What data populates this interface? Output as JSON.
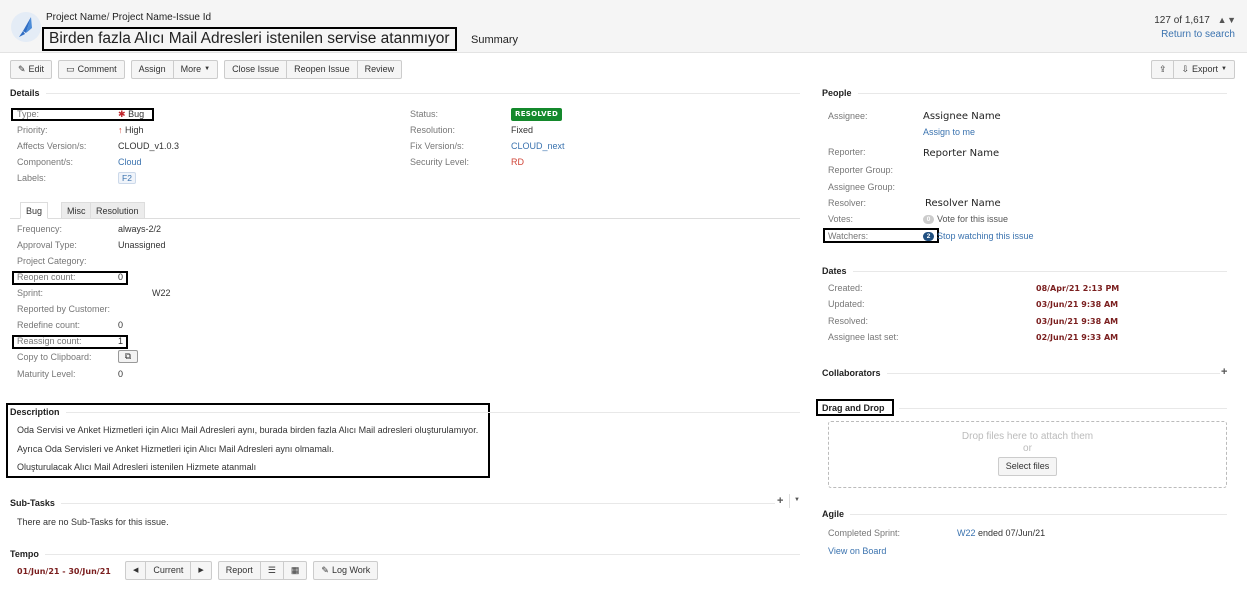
{
  "header": {
    "breadcrumb": {
      "project": "Project Name",
      "separator": "/",
      "issue": "Project Name-Issue Id"
    },
    "summary": "Birden fazla Alıcı Mail Adresleri istenilen servise atanmıyor",
    "summary_label": "Summary",
    "pager": {
      "position": "127 of 1,617",
      "up_icon": "▲",
      "down_icon": "▼",
      "return_link": "Return to search"
    }
  },
  "toolbar": {
    "edit": "Edit",
    "comment": "Comment",
    "assign": "Assign",
    "more": "More",
    "close_issue": "Close Issue",
    "reopen_issue": "Reopen Issue",
    "review": "Review",
    "export": "Export"
  },
  "details": {
    "title": "Details",
    "left": [
      {
        "label": "Type:",
        "value": "Bug"
      },
      {
        "label": "Priority:",
        "value": "High"
      },
      {
        "label": "Affects Version/s:",
        "value": "CLOUD_v1.0.3"
      },
      {
        "label": "Component/s:",
        "value": "Cloud"
      },
      {
        "label": "Labels:",
        "value": "F2"
      }
    ],
    "right": [
      {
        "label": "Status:",
        "value": "RESOLVED"
      },
      {
        "label": "Resolution:",
        "value": "Fixed"
      },
      {
        "label": "Fix Version/s:",
        "value": "CLOUD_next"
      },
      {
        "label": "Security Level:",
        "value": "RD"
      }
    ]
  },
  "tabs": [
    {
      "label": "Bug",
      "active": true
    },
    {
      "label": "Misc",
      "active": false
    },
    {
      "label": "Resolution",
      "active": false
    }
  ],
  "custom_fields": [
    {
      "label": "Frequency:",
      "value": "always-2/2"
    },
    {
      "label": "Approval Type:",
      "value": "Unassigned"
    },
    {
      "label": "Project Category:",
      "value": ""
    },
    {
      "label": "Reopen count:",
      "value": "0"
    },
    {
      "label": "Sprint:",
      "value": "W22"
    },
    {
      "label": "Reported by Customer:",
      "value": ""
    },
    {
      "label": "Redefine count:",
      "value": "0"
    },
    {
      "label": "Reassign count:",
      "value": "1"
    },
    {
      "label": "Copy to Clipboard:",
      "value": ""
    },
    {
      "label": "Maturity Level:",
      "value": "0"
    }
  ],
  "description": {
    "title": "Description",
    "lines": [
      "Oda Servisi ve Anket Hizmetleri için Alıcı Mail Adresleri aynı, burada birden fazla Alıcı Mail adresleri oluşturulamıyor.",
      "Ayrıca Oda Servisleri ve Anket Hizmetleri için Alıcı Mail Adresleri aynı olmamalı.",
      "Oluşturulacak Alıcı Mail Adresleri istenilen Hizmete atanmalı"
    ]
  },
  "subtasks": {
    "title": "Sub-Tasks",
    "empty": "There are no Sub-Tasks for this issue."
  },
  "tempo": {
    "title": "Tempo",
    "range": "01/Jun/21 - 30/Jun/21",
    "current": "Current",
    "report": "Report",
    "log_work": "Log Work"
  },
  "people": {
    "title": "People",
    "assignee_label": "Assignee:",
    "assignee": "Assignee Name",
    "assign_to_me": "Assign to me",
    "reporter_label": "Reporter:",
    "reporter": "Reporter Name",
    "reporter_group_label": "Reporter Group:",
    "assignee_group_label": "Assignee Group:",
    "resolver_label": "Resolver:",
    "resolver": "Resolver Name",
    "votes_label": "Votes:",
    "votes_count": "0",
    "vote_link": "Vote for this issue",
    "watchers_label": "Watchers:",
    "watchers_count": "2",
    "watch_link": "Stop watching this issue"
  },
  "dates": {
    "title": "Dates",
    "items": [
      {
        "label": "Created:",
        "value": "08/Apr/21 2:13 PM"
      },
      {
        "label": "Updated:",
        "value": "03/Jun/21 9:38 AM"
      },
      {
        "label": "Resolved:",
        "value": "03/Jun/21 9:38 AM"
      },
      {
        "label": "Assignee last set:",
        "value": "02/Jun/21 9:33 AM"
      }
    ]
  },
  "collaborators": {
    "title": "Collaborators"
  },
  "drag_drop": {
    "title": "Drag and Drop",
    "hint": "Drop files here to attach them",
    "or": "or",
    "select": "Select files"
  },
  "agile": {
    "title": "Agile",
    "completed_label": "Completed Sprint:",
    "sprint": "W22",
    "ended": "ended 07/Jun/21",
    "view_on_board": "View on Board"
  },
  "colors": {
    "link": "#3b73af",
    "resolved": "#14892c",
    "security": "#d04437",
    "date": "#7a1e1e",
    "watch_badge": "#205081"
  }
}
